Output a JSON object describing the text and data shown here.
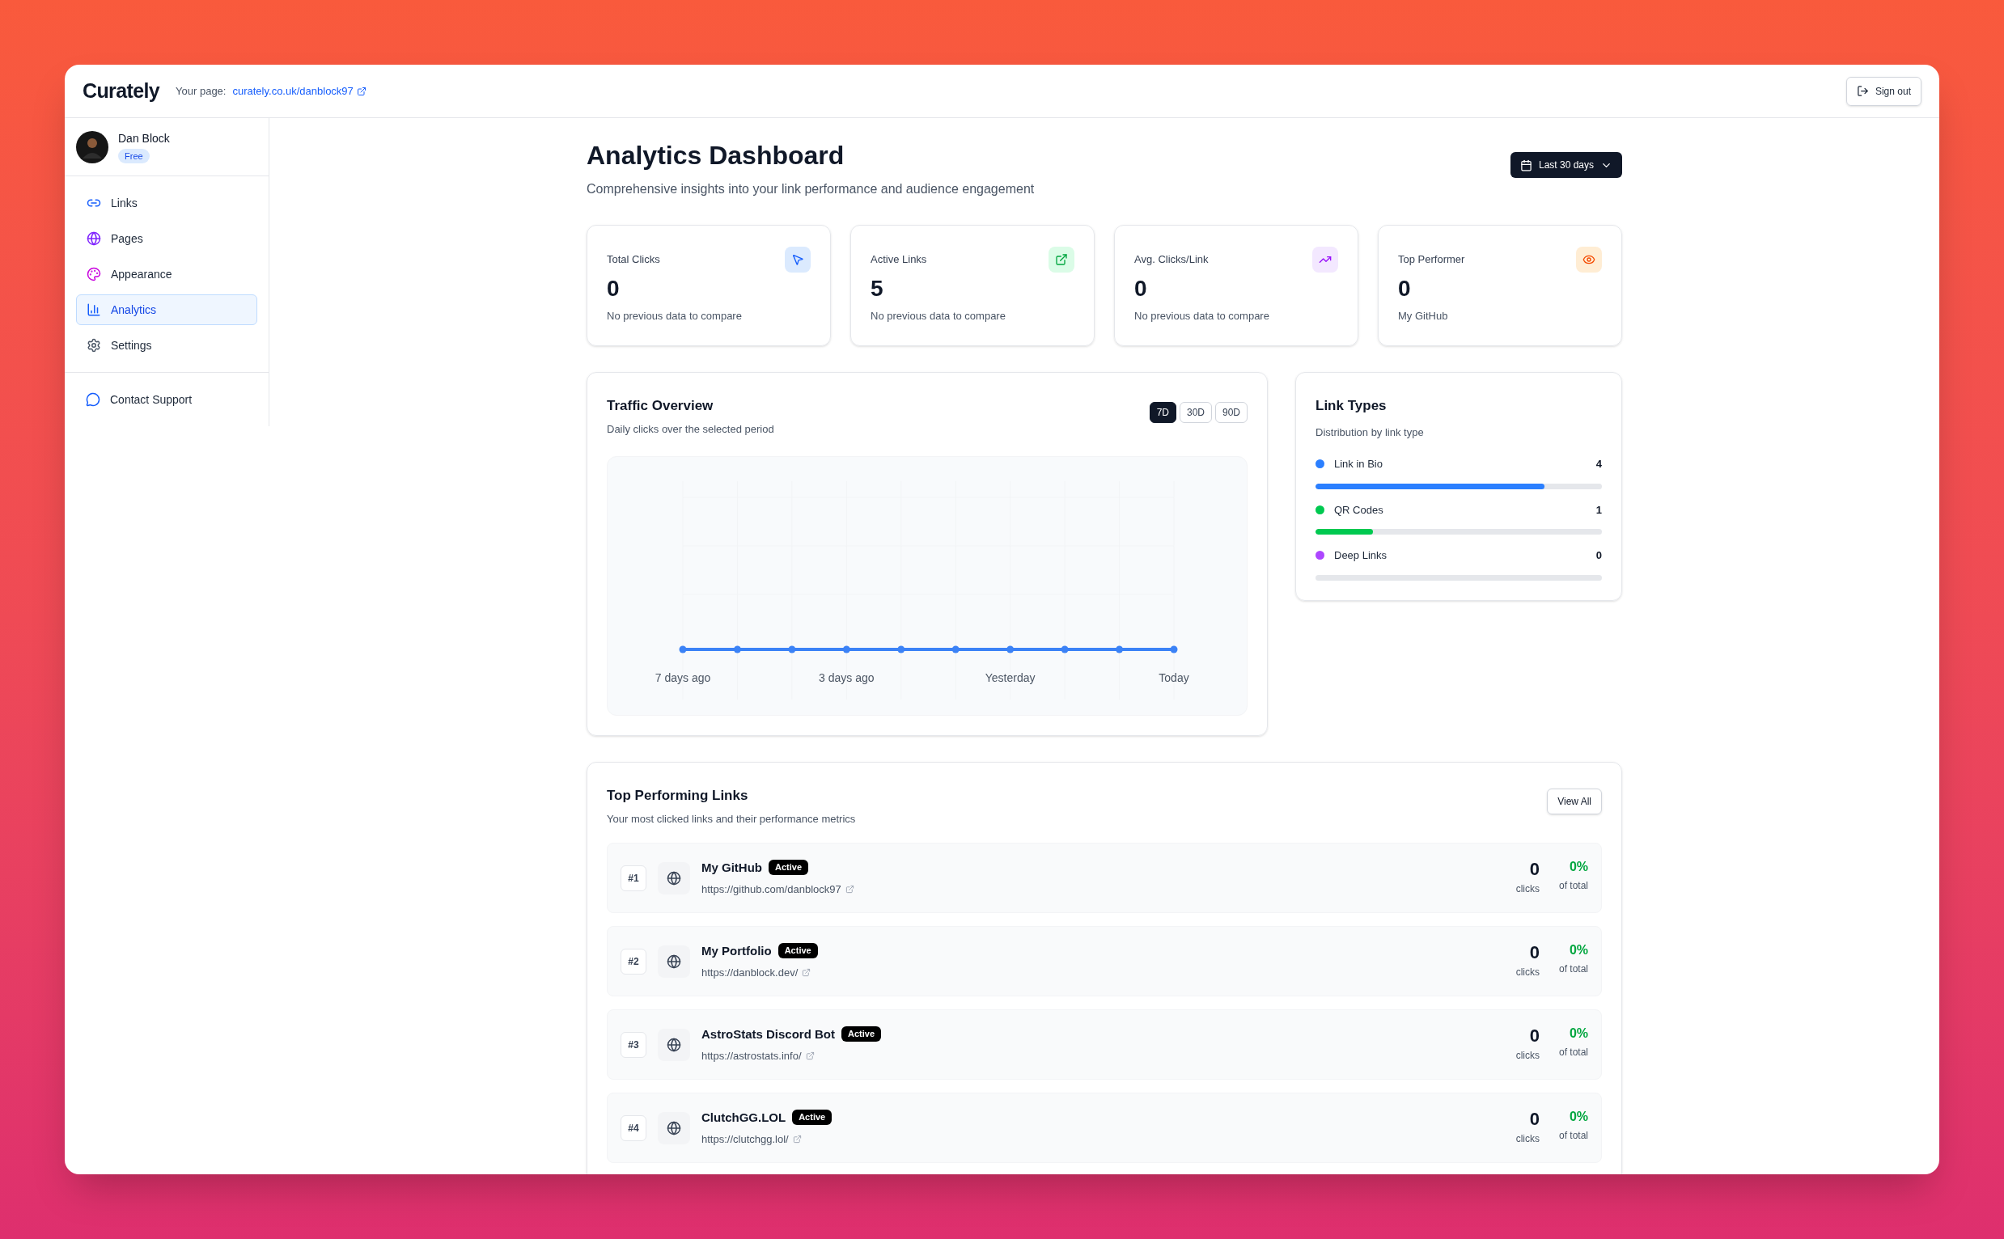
{
  "app": {
    "logo": "Curately",
    "page_label": "Your page:",
    "page_url": "curately.co.uk/danblock97",
    "sign_out": "Sign out"
  },
  "user": {
    "name": "Dan Block",
    "plan": "Free"
  },
  "sidebar": {
    "items": [
      {
        "label": "Links",
        "selected": false
      },
      {
        "label": "Pages",
        "selected": false
      },
      {
        "label": "Appearance",
        "selected": false
      },
      {
        "label": "Analytics",
        "selected": true
      },
      {
        "label": "Settings",
        "selected": false
      }
    ],
    "support": "Contact Support"
  },
  "dashboard": {
    "title": "Analytics Dashboard",
    "subtitle": "Comprehensive insights into your link performance and audience engagement",
    "range": "Last 30 days"
  },
  "stats": [
    {
      "label": "Total Clicks",
      "value": "0",
      "note": "No previous data to compare"
    },
    {
      "label": "Active Links",
      "value": "5",
      "note": "No previous data to compare"
    },
    {
      "label": "Avg. Clicks/Link",
      "value": "0",
      "note": "No previous data to compare"
    },
    {
      "label": "Top Performer",
      "value": "0",
      "note": "My GitHub"
    }
  ],
  "traffic": {
    "title": "Traffic Overview",
    "subtitle": "Daily clicks over the selected period",
    "ranges": [
      {
        "label": "7D",
        "selected": true
      },
      {
        "label": "30D",
        "selected": false
      },
      {
        "label": "90D",
        "selected": false
      }
    ],
    "x_labels": [
      "7 days ago",
      "3 days ago",
      "Yesterday",
      "Today"
    ]
  },
  "link_types": {
    "title": "Link Types",
    "subtitle": "Distribution by link type",
    "items": [
      {
        "name": "Link in Bio",
        "count": "4",
        "level": 0.8,
        "color": "#2b7fff"
      },
      {
        "name": "QR Codes",
        "count": "1",
        "level": 0.2,
        "color": "#00c950"
      },
      {
        "name": "Deep Links",
        "count": "0",
        "level": 0,
        "color": "#ad46ff"
      }
    ]
  },
  "top_links": {
    "title": "Top Performing Links",
    "subtitle": "Your most clicked links and their performance metrics",
    "view_all": "View All",
    "rows": [
      {
        "rank": "#1",
        "name": "My GitHub",
        "status": "Active",
        "url": "https://github.com/danblock97",
        "clicks": "0",
        "clicks_label": "clicks",
        "share": "0%",
        "share_label": "of total"
      },
      {
        "rank": "#2",
        "name": "My Portfolio",
        "status": "Active",
        "url": "https://danblock.dev/",
        "clicks": "0",
        "clicks_label": "clicks",
        "share": "0%",
        "share_label": "of total"
      },
      {
        "rank": "#3",
        "name": "AstroStats Discord Bot",
        "status": "Active",
        "url": "https://astrostats.info/",
        "clicks": "0",
        "clicks_label": "clicks",
        "share": "0%",
        "share_label": "of total"
      },
      {
        "rank": "#4",
        "name": "ClutchGG.LOL",
        "status": "Active",
        "url": "https://clutchgg.lol/",
        "clicks": "0",
        "clicks_label": "clicks",
        "share": "0%",
        "share_label": "of total"
      }
    ]
  }
}
